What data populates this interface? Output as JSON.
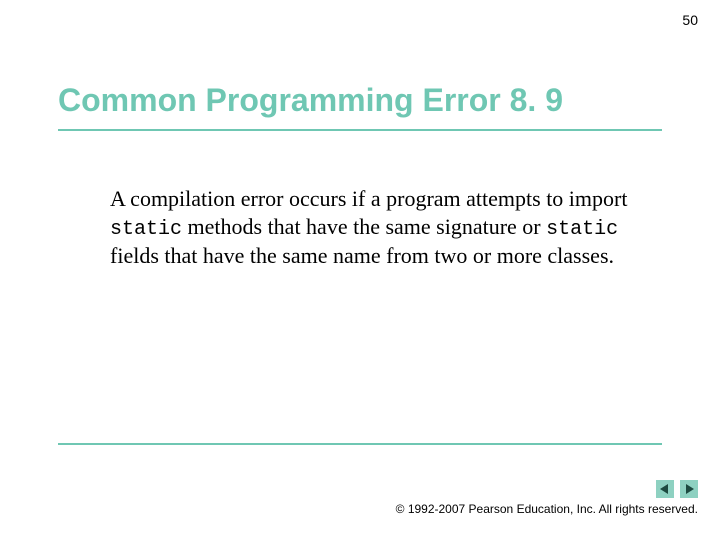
{
  "page_number": "50",
  "title": "Common Programming Error 8. 9",
  "body": {
    "part1": "A compilation error occurs if a program attempts to import ",
    "code1": "static",
    "part2": " methods that have the same signature or ",
    "code2": "static",
    "part3": " fields that have the same name from two or more classes."
  },
  "footer": {
    "copyright_symbol": "©",
    "text": " 1992-2007 Pearson Education, Inc.  All rights reserved."
  },
  "colors": {
    "accent": "#6fc7b3",
    "nav_bg": "#8ed1c1"
  }
}
